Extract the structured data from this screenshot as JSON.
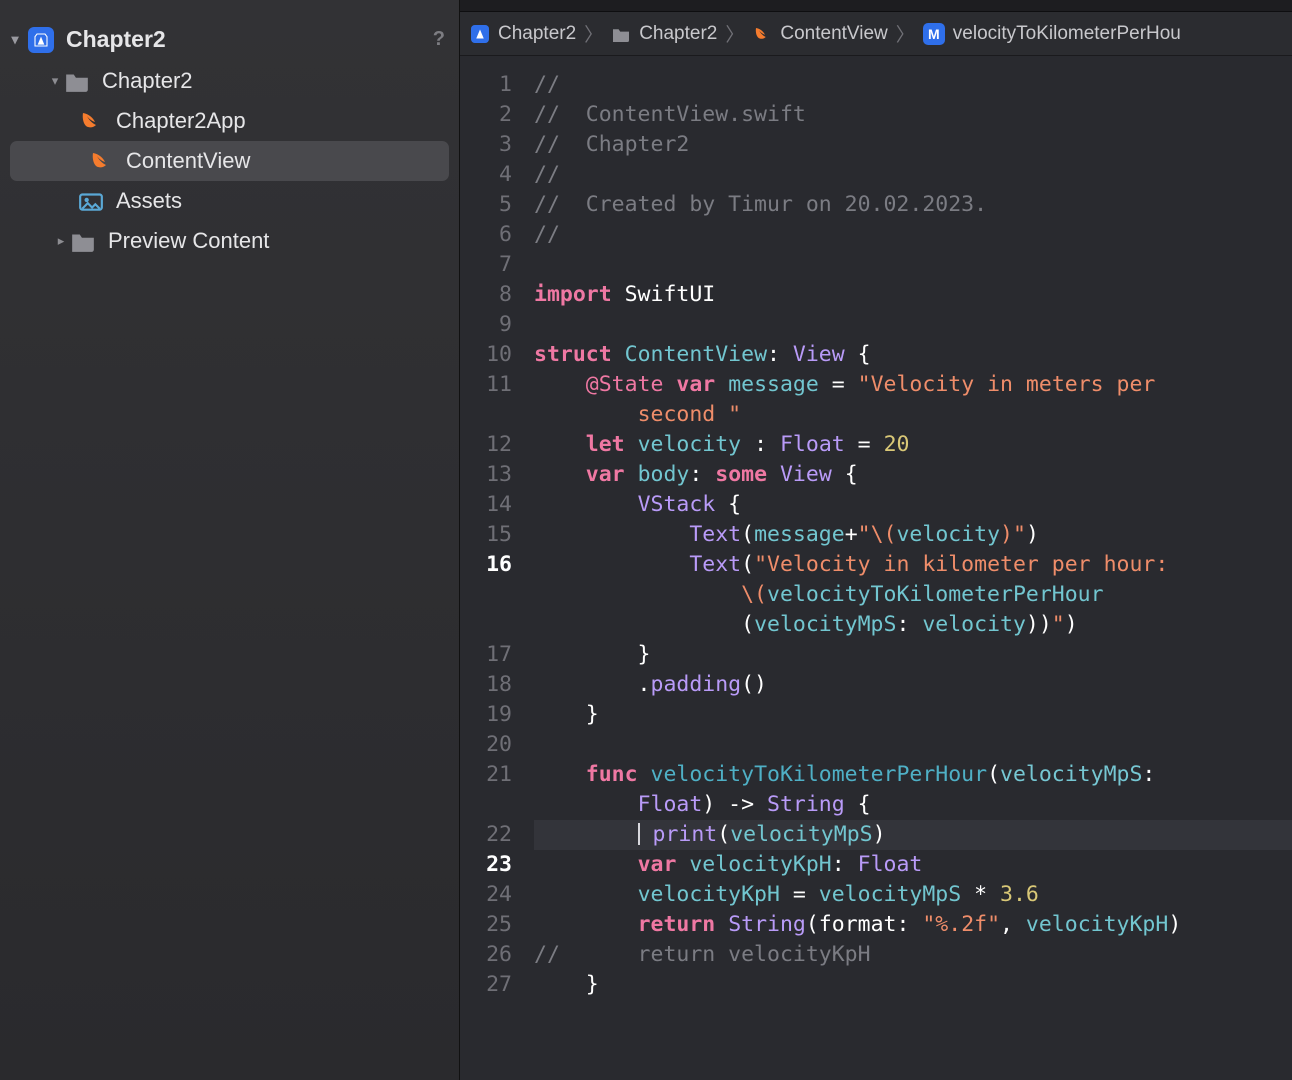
{
  "sidebar": {
    "project_name": "Chapter2",
    "help_glyph": "?",
    "items": [
      {
        "label": "Chapter2",
        "kind": "folder",
        "indent": 1,
        "disclosure": "open"
      },
      {
        "label": "Chapter2App",
        "kind": "swift",
        "indent": 2
      },
      {
        "label": "ContentView",
        "kind": "swift",
        "indent": 2,
        "selected": true
      },
      {
        "label": "Assets",
        "kind": "assets",
        "indent": 2
      },
      {
        "label": "Preview Content",
        "kind": "folder",
        "indent": 2,
        "disclosure": "closed"
      }
    ]
  },
  "breadcrumbs": {
    "items": [
      {
        "icon": "app",
        "label": "Chapter2"
      },
      {
        "icon": "folder",
        "label": "Chapter2"
      },
      {
        "icon": "swift",
        "label": "ContentView"
      },
      {
        "icon": "method",
        "label": "velocityToKilometerPerHou"
      }
    ]
  },
  "editor": {
    "highlighted_line": 22,
    "breakpoints": [
      16,
      23
    ],
    "lines": [
      {
        "n": 1,
        "tokens": [
          [
            "comment",
            "//"
          ]
        ]
      },
      {
        "n": 2,
        "tokens": [
          [
            "comment",
            "//  ContentView.swift"
          ]
        ]
      },
      {
        "n": 3,
        "tokens": [
          [
            "comment",
            "//  Chapter2"
          ]
        ]
      },
      {
        "n": 4,
        "tokens": [
          [
            "comment",
            "//"
          ]
        ]
      },
      {
        "n": 5,
        "tokens": [
          [
            "comment",
            "//  Created by Timur on 20.02.2023."
          ]
        ]
      },
      {
        "n": 6,
        "tokens": [
          [
            "comment",
            "//"
          ]
        ]
      },
      {
        "n": 7,
        "tokens": [
          [
            "plain",
            ""
          ]
        ]
      },
      {
        "n": 8,
        "tokens": [
          [
            "kw",
            "import"
          ],
          [
            "plain",
            " SwiftUI"
          ]
        ]
      },
      {
        "n": 9,
        "tokens": [
          [
            "plain",
            ""
          ]
        ]
      },
      {
        "n": 10,
        "tokens": [
          [
            "kw",
            "struct"
          ],
          [
            "plain",
            " "
          ],
          [
            "id",
            "ContentView"
          ],
          [
            "plain",
            ": "
          ],
          [
            "type2",
            "View"
          ],
          [
            "plain",
            " {"
          ]
        ]
      },
      {
        "n": 11,
        "tokens": [
          [
            "plain",
            "    "
          ],
          [
            "attr",
            "@State"
          ],
          [
            "plain",
            " "
          ],
          [
            "kw",
            "var"
          ],
          [
            "plain",
            " "
          ],
          [
            "id",
            "message"
          ],
          [
            "plain",
            " = "
          ],
          [
            "str",
            "\"Velocity in meters per "
          ]
        ]
      },
      {
        "n": 11,
        "cont": true,
        "tokens": [
          [
            "plain",
            "        "
          ],
          [
            "str",
            "second \""
          ]
        ]
      },
      {
        "n": 12,
        "tokens": [
          [
            "plain",
            "    "
          ],
          [
            "kw",
            "let"
          ],
          [
            "plain",
            " "
          ],
          [
            "id",
            "velocity"
          ],
          [
            "plain",
            " : "
          ],
          [
            "type2",
            "Float"
          ],
          [
            "plain",
            " = "
          ],
          [
            "num",
            "20"
          ]
        ]
      },
      {
        "n": 13,
        "tokens": [
          [
            "plain",
            "    "
          ],
          [
            "kw",
            "var"
          ],
          [
            "plain",
            " "
          ],
          [
            "id",
            "body"
          ],
          [
            "plain",
            ": "
          ],
          [
            "kw",
            "some"
          ],
          [
            "plain",
            " "
          ],
          [
            "type2",
            "View"
          ],
          [
            "plain",
            " {"
          ]
        ]
      },
      {
        "n": 14,
        "tokens": [
          [
            "plain",
            "        "
          ],
          [
            "type2",
            "VStack"
          ],
          [
            "plain",
            " {"
          ]
        ]
      },
      {
        "n": 15,
        "tokens": [
          [
            "plain",
            "            "
          ],
          [
            "type2",
            "Text"
          ],
          [
            "plain",
            "("
          ],
          [
            "id",
            "message"
          ],
          [
            "plain",
            "+"
          ],
          [
            "str",
            "\"\\("
          ],
          [
            "id",
            "velocity"
          ],
          [
            "str",
            ")\""
          ],
          [
            "plain",
            ")"
          ]
        ]
      },
      {
        "n": 16,
        "tokens": [
          [
            "plain",
            "            "
          ],
          [
            "type2",
            "Text"
          ],
          [
            "plain",
            "("
          ],
          [
            "str",
            "\"Velocity in kilometer per hour: "
          ]
        ]
      },
      {
        "n": 16,
        "cont": true,
        "tokens": [
          [
            "plain",
            "                "
          ],
          [
            "str",
            "\\("
          ],
          [
            "id",
            "velocityToKilometerPerHour"
          ]
        ]
      },
      {
        "n": 16,
        "cont": true,
        "tokens": [
          [
            "plain",
            "                "
          ],
          [
            "plain",
            "("
          ],
          [
            "id",
            "velocityMpS"
          ],
          [
            "plain",
            ": "
          ],
          [
            "id",
            "velocity"
          ],
          [
            "plain",
            "))"
          ],
          [
            "str",
            "\""
          ],
          [
            "plain",
            ")"
          ]
        ]
      },
      {
        "n": 17,
        "tokens": [
          [
            "plain",
            "        }"
          ]
        ]
      },
      {
        "n": 18,
        "tokens": [
          [
            "plain",
            "        ."
          ],
          [
            "method",
            "padding"
          ],
          [
            "plain",
            "()"
          ]
        ]
      },
      {
        "n": 19,
        "tokens": [
          [
            "plain",
            "    }"
          ]
        ]
      },
      {
        "n": 20,
        "tokens": [
          [
            "plain",
            ""
          ]
        ]
      },
      {
        "n": 21,
        "tokens": [
          [
            "plain",
            "    "
          ],
          [
            "kw",
            "func"
          ],
          [
            "plain",
            " "
          ],
          [
            "func",
            "velocityToKilometerPerHour"
          ],
          [
            "plain",
            "("
          ],
          [
            "param",
            "velocityMpS"
          ],
          [
            "plain",
            ": "
          ]
        ]
      },
      {
        "n": 21,
        "cont": true,
        "tokens": [
          [
            "plain",
            "        "
          ],
          [
            "type2",
            "Float"
          ],
          [
            "plain",
            ") -> "
          ],
          [
            "type2",
            "String"
          ],
          [
            "plain",
            " {"
          ]
        ]
      },
      {
        "n": 22,
        "tokens": [
          [
            "plain",
            "        "
          ],
          [
            "cursor",
            ""
          ],
          [
            "plain",
            " "
          ],
          [
            "method",
            "print"
          ],
          [
            "plain",
            "("
          ],
          [
            "id",
            "velocityMpS"
          ],
          [
            "plain",
            ")"
          ]
        ]
      },
      {
        "n": 23,
        "tokens": [
          [
            "plain",
            "        "
          ],
          [
            "kw",
            "var"
          ],
          [
            "plain",
            " "
          ],
          [
            "id",
            "velocityKpH"
          ],
          [
            "plain",
            ": "
          ],
          [
            "type2",
            "Float"
          ]
        ]
      },
      {
        "n": 24,
        "tokens": [
          [
            "plain",
            "        "
          ],
          [
            "id",
            "velocityKpH"
          ],
          [
            "plain",
            " = "
          ],
          [
            "id",
            "velocityMpS"
          ],
          [
            "plain",
            " * "
          ],
          [
            "num",
            "3.6"
          ]
        ]
      },
      {
        "n": 25,
        "tokens": [
          [
            "plain",
            "        "
          ],
          [
            "kw",
            "return"
          ],
          [
            "plain",
            " "
          ],
          [
            "type2",
            "String"
          ],
          [
            "plain",
            "(format: "
          ],
          [
            "str",
            "\"%.2f\""
          ],
          [
            "plain",
            ", "
          ],
          [
            "id",
            "velocityKpH"
          ],
          [
            "plain",
            ")"
          ]
        ]
      },
      {
        "n": 26,
        "tokens": [
          [
            "comment",
            "//      return velocityKpH"
          ]
        ]
      },
      {
        "n": 27,
        "tokens": [
          [
            "plain",
            "    }"
          ]
        ]
      }
    ]
  }
}
